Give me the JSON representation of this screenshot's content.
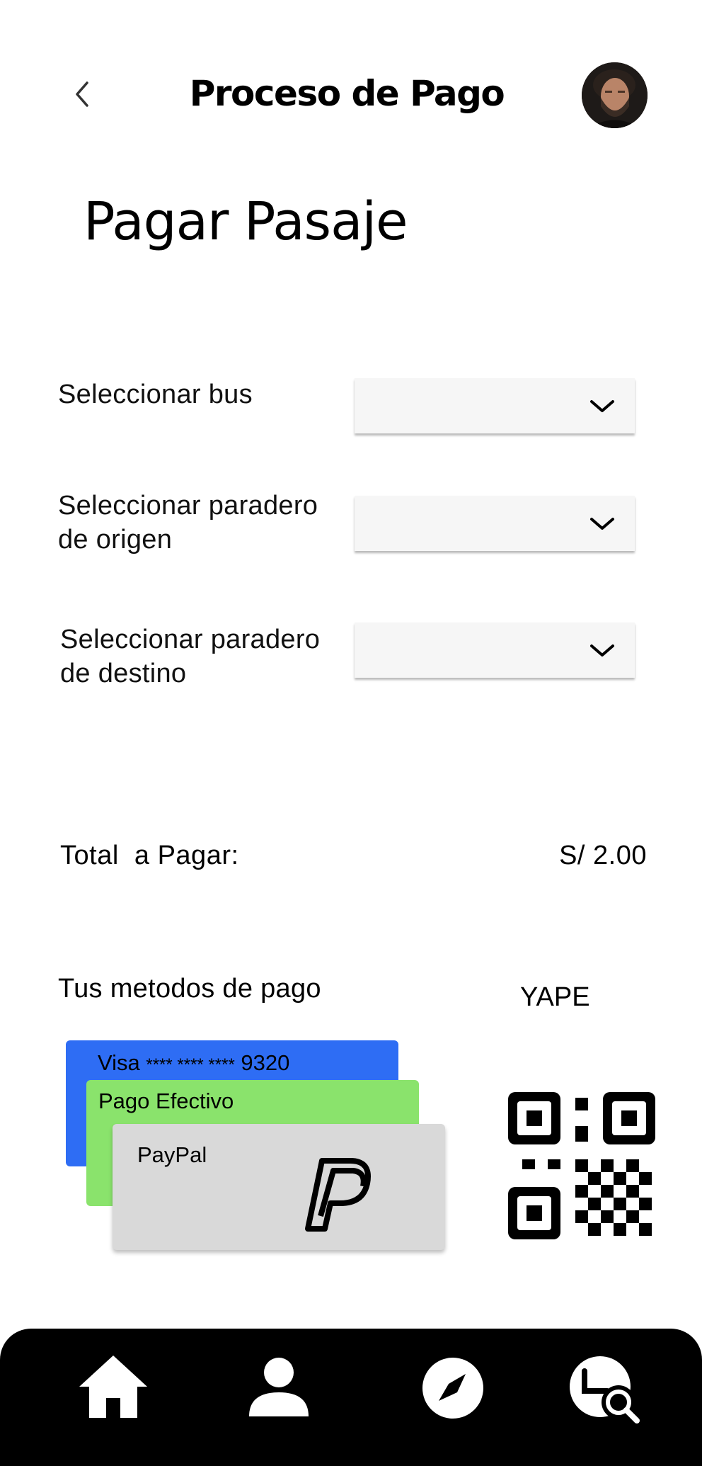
{
  "header": {
    "title": "Proceso de Pago",
    "back_icon": "chevron-left-icon",
    "avatar_icon": "user-avatar"
  },
  "section_title": "Pagar Pasaje",
  "form": {
    "bus": {
      "label": "Seleccionar bus",
      "value": ""
    },
    "origin": {
      "label_line1": "Seleccionar paradero",
      "label_line2": "de origen",
      "value": ""
    },
    "destination": {
      "label_line1": "Seleccionar paradero",
      "label_line2": "de destino",
      "value": ""
    }
  },
  "total": {
    "label": "Total  a Pagar:",
    "amount": "S/ 2.00"
  },
  "payment": {
    "title": "Tus metodos de pago",
    "cards": [
      {
        "prefix": "Visa",
        "mask": "**** **** ****",
        "last4": "9320",
        "color": "#2e6df4"
      },
      {
        "label": "Pago Efectivo",
        "color": "#8ae36c"
      },
      {
        "label": "PayPal",
        "color": "#d9d9d9",
        "icon": "paypal-logo-icon"
      }
    ],
    "yape": {
      "label": "YAPE",
      "icon": "qr-code-icon"
    }
  },
  "nav": {
    "items": [
      {
        "icon": "home-icon"
      },
      {
        "icon": "user-icon"
      },
      {
        "icon": "compass-icon"
      },
      {
        "icon": "history-search-icon"
      }
    ],
    "background": "#000000"
  }
}
